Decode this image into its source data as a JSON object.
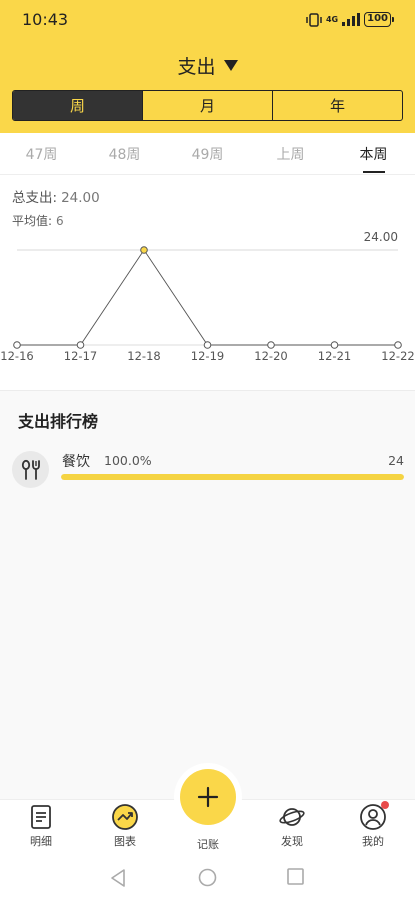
{
  "status": {
    "time": "10:43",
    "network": "4G",
    "battery": "100"
  },
  "header": {
    "title": "支出"
  },
  "segment": {
    "items": [
      "周",
      "月",
      "年"
    ],
    "active": 0
  },
  "weeks": {
    "items": [
      "47周",
      "48周",
      "49周",
      "上周",
      "本周"
    ],
    "active": 4
  },
  "summary": {
    "total_label": "总支出:",
    "total_value": "24.00",
    "avg_label": "平均值:",
    "avg_value": "6"
  },
  "chart_data": {
    "type": "line",
    "x": [
      "12-16",
      "12-17",
      "12-18",
      "12-19",
      "12-20",
      "12-21",
      "12-22"
    ],
    "values": [
      0,
      0,
      24,
      0,
      0,
      0,
      0
    ],
    "max_label": "24.00",
    "ylim": [
      0,
      24
    ],
    "highlight_color": "#fad749"
  },
  "ranking": {
    "title": "支出排行榜",
    "items": [
      {
        "name": "餐饮",
        "percent": "100.0%",
        "amount": "24",
        "fraction": 1.0,
        "icon": "dining-icon"
      }
    ]
  },
  "nav": {
    "items": [
      "明细",
      "图表",
      "记账",
      "发现",
      "我的"
    ]
  },
  "colors": {
    "brand": "#fad749",
    "dark": "#333333"
  }
}
